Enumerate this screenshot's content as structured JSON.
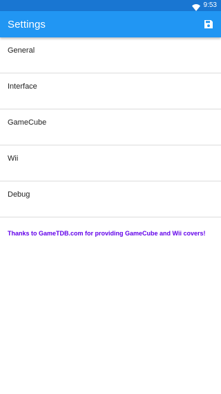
{
  "status_bar": {
    "time": "9:53",
    "wifi_icon": "wifi-icon"
  },
  "app_bar": {
    "title": "Settings",
    "save_icon": "save-icon",
    "background": "#2196F3"
  },
  "settings_items": [
    {
      "label": "General"
    },
    {
      "label": "Interface"
    },
    {
      "label": "GameCube"
    },
    {
      "label": "Wii"
    },
    {
      "label": "Debug"
    }
  ],
  "footer": {
    "thanks_text": "Thanks to GameTDB.com for providing GameCube and Wii covers!",
    "link_color": "#6200EA"
  }
}
